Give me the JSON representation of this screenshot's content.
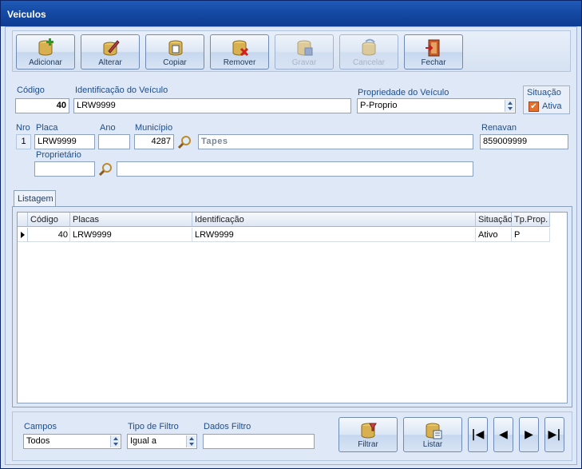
{
  "window": {
    "title": "Veiculos"
  },
  "toolbar": {
    "add": "Adicionar",
    "edit": "Alterar",
    "copy": "Copiar",
    "remove": "Remover",
    "save": "Gravar",
    "cancel": "Cancelar",
    "close": "Fechar"
  },
  "form": {
    "codigo_label": "Código",
    "codigo_value": "40",
    "identificacao_label": "Identificação do Veículo",
    "identificacao_value": "LRW9999",
    "propriedade_label": "Propriedade do Veículo",
    "propriedade_value": "P-Proprio",
    "situacao_label": "Situação",
    "situacao_check_label": "Ativa",
    "situacao_checked": true,
    "nro_label": "Nro",
    "nro_value": "1",
    "placa_label": "Placa",
    "placa_value": "LRW9999",
    "ano_label": "Ano",
    "ano_value": "",
    "municipio_label": "Município",
    "municipio_code": "4287",
    "municipio_name": "Tapes",
    "renavan_label": "Renavan",
    "renavan_value": "859009999",
    "proprietario_label": "Proprietário",
    "proprietario_code": "",
    "proprietario_name": ""
  },
  "tabs": {
    "listagem": "Listagem"
  },
  "grid": {
    "columns": [
      "Código",
      "Placas",
      "Identificação",
      "Situação",
      "Tp.Prop."
    ],
    "rows": [
      [
        "40",
        "LRW9999",
        "LRW9999",
        "Ativo",
        "P"
      ]
    ]
  },
  "filter": {
    "campos_label": "Campos",
    "campos_value": "Todos",
    "tipo_label": "Tipo de Filtro",
    "tipo_value": "Igual a",
    "dados_label": "Dados Filtro",
    "dados_value": "",
    "filtrar": "Filtrar",
    "listar": "Listar",
    "nav_first": "|◀",
    "nav_prev": "◀",
    "nav_next": "▶",
    "nav_last": "▶|"
  }
}
